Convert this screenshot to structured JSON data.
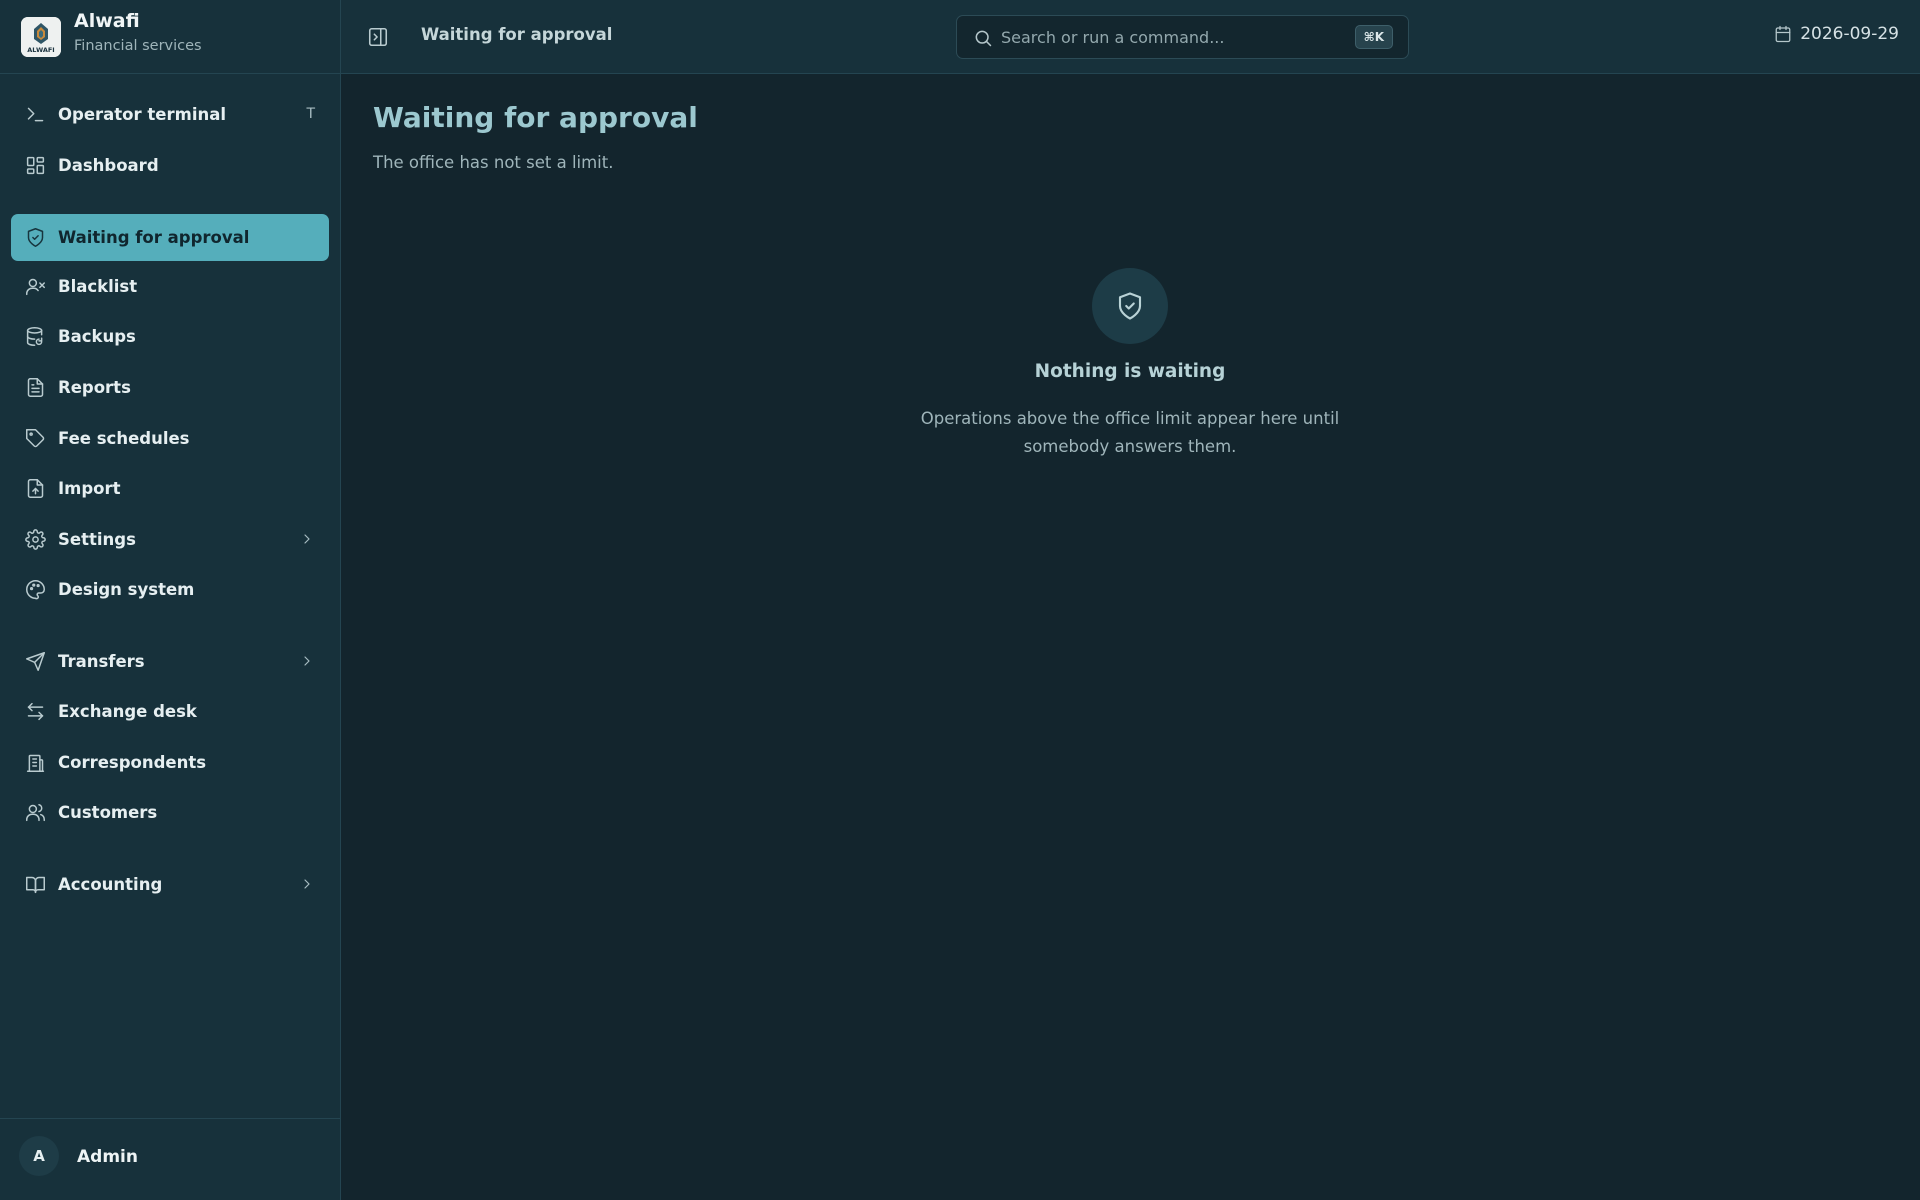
{
  "brand": {
    "name": "Alwafi",
    "subtitle": "Financial services",
    "logo_text": "ALWAFI"
  },
  "topbar": {
    "breadcrumb": "Waiting for approval",
    "search": {
      "placeholder": "Search or run a command...",
      "shortcut": "⌘K"
    },
    "date": "2026-09-29"
  },
  "sidebar": {
    "items": [
      {
        "label": "Operator terminal",
        "icon": "terminal-icon",
        "shortcut": "T"
      },
      {
        "label": "Dashboard",
        "icon": "dashboard-icon"
      },
      {
        "label": "Waiting for approval",
        "icon": "shield-check-icon",
        "active": true
      },
      {
        "label": "Blacklist",
        "icon": "user-x-icon"
      },
      {
        "label": "Backups",
        "icon": "database-icon"
      },
      {
        "label": "Reports",
        "icon": "file-text-icon"
      },
      {
        "label": "Fee schedules",
        "icon": "tag-icon"
      },
      {
        "label": "Import",
        "icon": "file-upload-icon"
      },
      {
        "label": "Settings",
        "icon": "gear-icon",
        "expandable": true
      },
      {
        "label": "Design system",
        "icon": "palette-icon"
      },
      {
        "label": "Transfers",
        "icon": "send-icon",
        "expandable": true
      },
      {
        "label": "Exchange desk",
        "icon": "arrows-exchange-icon"
      },
      {
        "label": "Correspondents",
        "icon": "building-icon"
      },
      {
        "label": "Customers",
        "icon": "users-icon"
      },
      {
        "label": "Accounting",
        "icon": "book-icon",
        "expandable": true
      }
    ],
    "user": {
      "initial": "A",
      "name": "Admin"
    }
  },
  "main": {
    "title": "Waiting for approval",
    "subtitle": "The office has not set a limit.",
    "empty_state": {
      "icon": "shield-check-icon",
      "title": "Nothing is waiting",
      "description": "Operations above the office limit appear here until somebody answers them."
    }
  },
  "colors": {
    "accent": "#55aebb",
    "background": "#13252d",
    "sidebar": "#17313b",
    "title": "#9cc8cf"
  }
}
